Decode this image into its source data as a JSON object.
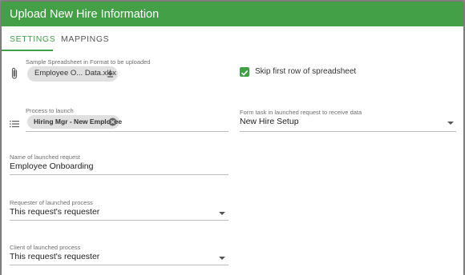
{
  "dialog": {
    "title": "Upload New Hire Information"
  },
  "tabs": [
    {
      "label": "SETTINGS",
      "active": true
    },
    {
      "label": "MAPPINGS",
      "active": false
    }
  ],
  "form": {
    "sample_spreadsheet": {
      "label": "Sample Spreadsheet in Format to be uploaded",
      "file_name": "Employee O... Data.xlsx"
    },
    "skip_first_row": {
      "label": "Skip first row of spreadsheet",
      "checked": true
    },
    "process_to_launch": {
      "label": "Process to launch",
      "value": "Hiring Mgr - New Employee"
    },
    "form_task": {
      "label": "Form task in launched request to receive data",
      "value": "New Hire Setup"
    },
    "request_name": {
      "label": "Name of launched request",
      "value": "Employee Onboarding"
    },
    "requester": {
      "label": "Requester of launched process",
      "value": "This request's requester"
    },
    "client": {
      "label": "Client of launched process",
      "value": "This request's requester"
    }
  },
  "colors": {
    "accent": "#43a047",
    "chip": "#e0e0e0"
  },
  "icons": {
    "attach": "paperclip-icon",
    "download": "download-icon",
    "process": "list-icon",
    "remove": "close-circle-icon",
    "dropdown": "caret-down-icon",
    "check": "check-icon"
  }
}
